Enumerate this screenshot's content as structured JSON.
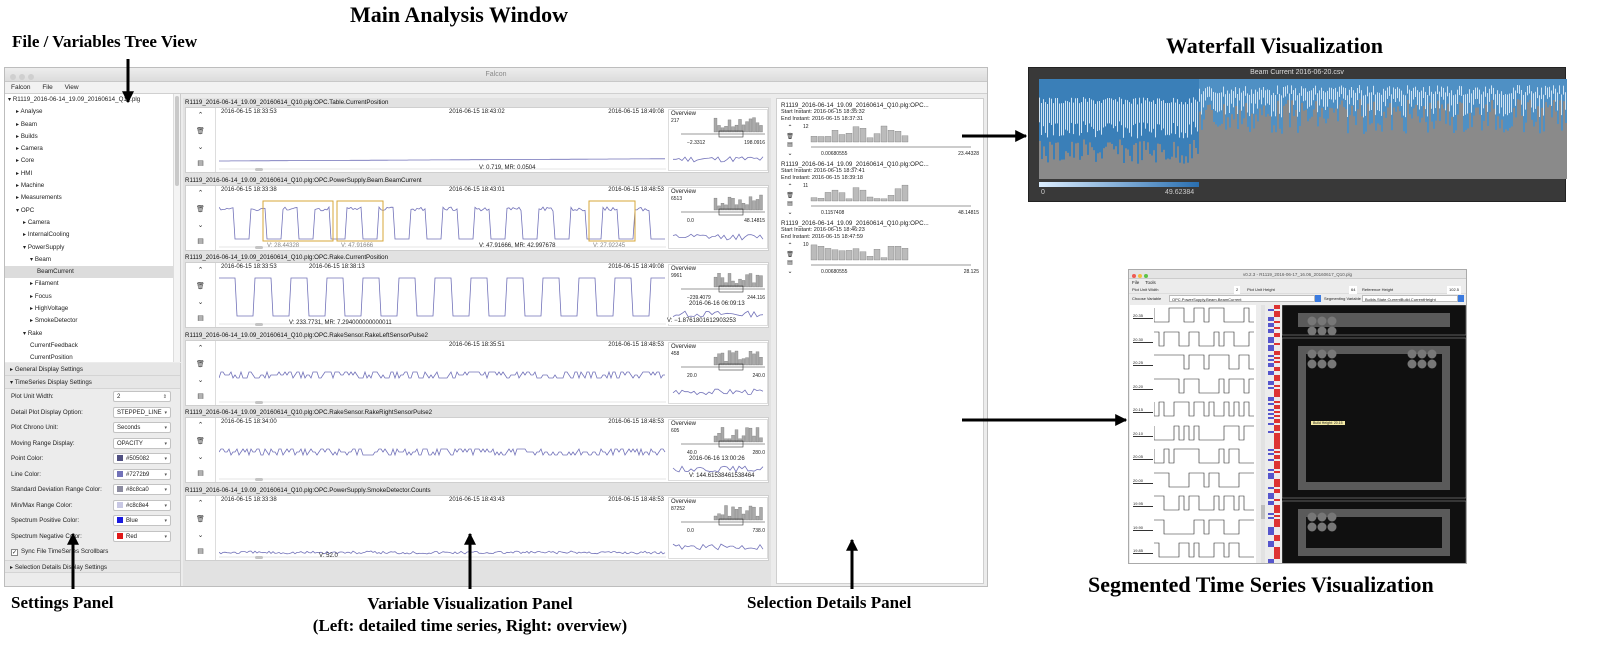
{
  "annotations": {
    "main_window": "Main Analysis Window",
    "tree_view": "File / Variables Tree View",
    "waterfall": "Waterfall Visualization",
    "settings_panel": "Settings Panel",
    "variable_panel_line1": "Variable Visualization Panel",
    "variable_panel_line2": "(Left: detailed time series, Right: overview)",
    "selection_panel": "Selection Details Panel",
    "segmented": "Segmented Time Series Visualization"
  },
  "window": {
    "title": "Falcon",
    "menu": [
      "Falcon",
      "File",
      "View"
    ]
  },
  "tree": {
    "root": "R1119_2016-06-14_19.09_20160614_Q10.plg",
    "items": [
      {
        "label": "Analyse",
        "level": 1,
        "arrow": "▸"
      },
      {
        "label": "Beam",
        "level": 1,
        "arrow": "▸"
      },
      {
        "label": "Builds",
        "level": 1,
        "arrow": "▸"
      },
      {
        "label": "Camera",
        "level": 1,
        "arrow": "▸"
      },
      {
        "label": "Core",
        "level": 1,
        "arrow": "▸"
      },
      {
        "label": "HMI",
        "level": 1,
        "arrow": "▸"
      },
      {
        "label": "Machine",
        "level": 1,
        "arrow": "▸"
      },
      {
        "label": "Measurements",
        "level": 1,
        "arrow": "▸"
      },
      {
        "label": "OPC",
        "level": 1,
        "arrow": "▾"
      },
      {
        "label": "Camera",
        "level": 2,
        "arrow": "▸"
      },
      {
        "label": "InternalCooling",
        "level": 2,
        "arrow": "▸"
      },
      {
        "label": "PowerSupply",
        "level": 2,
        "arrow": "▾"
      },
      {
        "label": "Beam",
        "level": 3,
        "arrow": "▾"
      },
      {
        "label": "BeamCurrent",
        "level": 4,
        "arrow": "",
        "selected": true
      },
      {
        "label": "Filament",
        "level": 3,
        "arrow": "▸"
      },
      {
        "label": "Focus",
        "level": 3,
        "arrow": "▸"
      },
      {
        "label": "HighVoltage",
        "level": 3,
        "arrow": "▸"
      },
      {
        "label": "SmokeDetector",
        "level": 3,
        "arrow": "▸"
      },
      {
        "label": "Rake",
        "level": 2,
        "arrow": "▾"
      },
      {
        "label": "CurrentFeedback",
        "level": 3,
        "arrow": ""
      },
      {
        "label": "CurrentPosition",
        "level": 3,
        "arrow": ""
      }
    ]
  },
  "settings": {
    "general_header": "General Display Settings",
    "timeseries_header": "TimeSeries Display Settings",
    "selection_header": "Selection Details Display Settings",
    "rows": [
      {
        "label": "Plot Unit Width:",
        "value": "2",
        "kind": "spinner"
      },
      {
        "label": "Detail Plot Display Option:",
        "value": "STEPPED_LINE",
        "kind": "select"
      },
      {
        "label": "Plot Chrono Unit:",
        "value": "Seconds",
        "kind": "select"
      },
      {
        "label": "Moving Range Display:",
        "value": "OPACITY",
        "kind": "select"
      },
      {
        "label": "Point Color:",
        "value": "#505082",
        "kind": "color",
        "swatch": "#505082"
      },
      {
        "label": "Line Color:",
        "value": "#7272b9",
        "kind": "color",
        "swatch": "#7272b9"
      },
      {
        "label": "Standard Deviation Range Color:",
        "value": "#8c8ca0",
        "kind": "color",
        "swatch": "#8c8ca0"
      },
      {
        "label": "Min/Max Range Color:",
        "value": "#c8c8e4",
        "kind": "color",
        "swatch": "#c8c8e4"
      },
      {
        "label": "Spectrum Positive Color:",
        "value": "Blue",
        "kind": "color",
        "swatch": "#1a1adf"
      },
      {
        "label": "Spectrum Negative Color:",
        "value": "Red",
        "kind": "color",
        "swatch": "#e01818"
      }
    ],
    "sync_label": "Sync File TimeSeries Scrollbars"
  },
  "variables": [
    {
      "title": "R1119_2016-06-14_19.09_20160614_Q10.plg:OPC.Table.CurrentPosition",
      "t_start": "2016-06-15 18:33:53",
      "t_mid": "2016-06-15 18:43:02",
      "t_end": "2016-06-15 18:49:08",
      "readout": "V: 0.719, MR: 0.0504",
      "ov_min": "−2.3312",
      "ov_max": "198.0916",
      "ov_count": "217",
      "ov_time": ""
    },
    {
      "title": "R1119_2016-06-14_19.09_20160614_Q10.plg:OPC.PowerSupply.Beam.BeamCurrent",
      "t_start": "2016-06-15 18:33:38",
      "t_mid": "2016-06-15 18:43:01",
      "t_end": "2016-06-15 18:48:53",
      "readout": "V: 47.91666, MR: 42.997678",
      "ov_min": "0.0",
      "ov_max": "48.14815",
      "ov_count": "6513",
      "ov_time": "",
      "sel_labels": [
        "V: 28.44328",
        "V: 47.91666",
        "V: 27.92245"
      ]
    },
    {
      "title": "R1119_2016-06-14_19.09_20160614_Q10.plg:OPC.Rake.CurrentPosition",
      "t_start": "2016-06-15 18:33:53",
      "t_mid": "2016-06-15 18:38:13",
      "t_end": "2016-06-15 18:49:08",
      "readout": "V: 233.7731, MR: 7.294000000000011",
      "ov_min": "−239.4079",
      "ov_max": "244.116",
      "ov_count": "9961",
      "ov_time": "2016-06-16 06:09:13",
      "ov_value": "V: −1.8761801612903253"
    },
    {
      "title": "R1119_2016-06-14_19.09_20160614_Q10.plg:OPC.RakeSensor.RakeLeftSensorPulse2",
      "t_start": "",
      "t_mid": "2016-06-15 18:35:51",
      "t_end": "2016-06-15 18:48:53",
      "readout": "",
      "ov_min": "20.0",
      "ov_max": "240.0",
      "ov_count": "458",
      "ov_time": ""
    },
    {
      "title": "R1119_2016-06-14_19.09_20160614_Q10.plg:OPC.RakeSensor.RakeRightSensorPulse2",
      "t_start": "2016-06-15 18:34:00",
      "t_mid": "",
      "t_end": "2016-06-15 18:48:53",
      "readout": "",
      "ov_min": "40.0",
      "ov_max": "280.0",
      "ov_count": "605",
      "ov_time": "2016-06-16 13:00:26",
      "ov_value": "V: 144.61538461538464"
    },
    {
      "title": "R1119_2016-06-14_19.09_20160614_Q10.plg:OPC.PowerSupply.SmokeDetector.Counts",
      "t_start": "2016-06-15 18:33:38",
      "t_mid": "2016-06-15 18:43:43",
      "t_end": "2016-06-15 18:48:53",
      "readout": "V: 52.0",
      "ov_min": "0.0",
      "ov_max": "738.0",
      "ov_count": "87252",
      "ov_time": ""
    }
  ],
  "overview_label": "Overview",
  "details": [
    {
      "title": "R1119_2016-06-14_19.09_20160614_Q10.plg:OPC...",
      "start": "Start Instant: 2016-06-15 18:35:32",
      "end": "End Instant: 2016-06-15 18:37:31",
      "min": "0.00680555",
      "max": "23.44328",
      "count": "12"
    },
    {
      "title": "R1119_2016-06-14_19.09_20160614_Q10.plg:OPC...",
      "start": "Start Instant: 2016-06-15 18:37:41",
      "end": "End Instant: 2016-06-15 18:39:18",
      "min": "0.1157408",
      "max": "48.14815",
      "count": "11"
    },
    {
      "title": "R1119_2016-06-14_19.09_20160614_Q10.plg:OPC...",
      "start": "Start Instant: 2016-06-15 18:46:23",
      "end": "End Instant: 2016-06-15 18:47:59",
      "min": "0.00680555",
      "max": "28.125",
      "count": "10"
    }
  ],
  "waterfall": {
    "title": "Beam Current 2016-06-20.csv",
    "scale_min": "0",
    "scale_max": "49.62384"
  },
  "segmented": {
    "title": "v0.2.3 - R1119_2016-06-17_16.06_20160617_Q10.plg",
    "menu": [
      "File",
      "Tools"
    ],
    "plot_unit_width_label": "Plot Unit Width",
    "plot_unit_width_value": "2",
    "plot_unit_height_label": "Plot Unit Height",
    "plot_unit_height_value": "64",
    "reference_height_label": "Reference Height",
    "reference_height_value": "102.5",
    "choose_variable_label": "Choose Variable",
    "choose_variable_value": "OPC.PowerSupply.Beam.BeamCurrent",
    "segmenting_variable_label": "Segmenting Variable",
    "segmenting_variable_value": "Builds.State.CurrentBuild.CurrentHeight",
    "row_labels": [
      "20.35",
      "20.30",
      "20.25",
      "20.20",
      "20.15",
      "20.10",
      "20.05",
      "20.00",
      "19.95",
      "19.90",
      "19.85"
    ],
    "tooltip": "Build Height: 20.15"
  }
}
